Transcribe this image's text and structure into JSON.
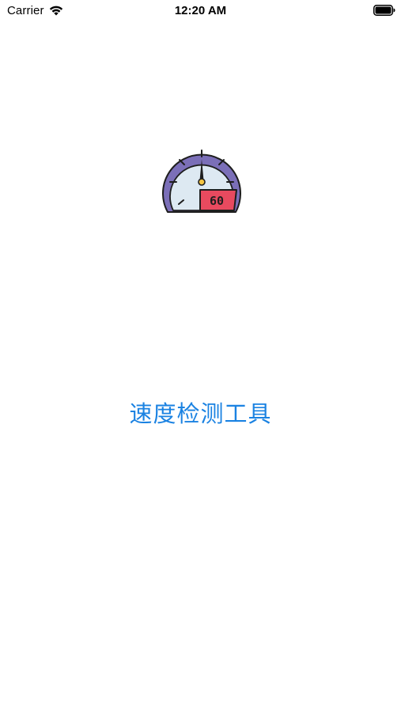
{
  "status_bar": {
    "carrier": "Carrier",
    "time": "12:20 AM",
    "icons": [
      "wifi-icon",
      "battery-icon"
    ]
  },
  "logo": {
    "icon": "speedometer-icon",
    "readout": "60",
    "colors": {
      "rim": "#7b6fb8",
      "face": "#dde9f2",
      "readout_bg": "#e84a5f",
      "needle_hub": "#f5c542"
    }
  },
  "app": {
    "title": "速度检测工具",
    "title_color": "#1a82e2"
  }
}
